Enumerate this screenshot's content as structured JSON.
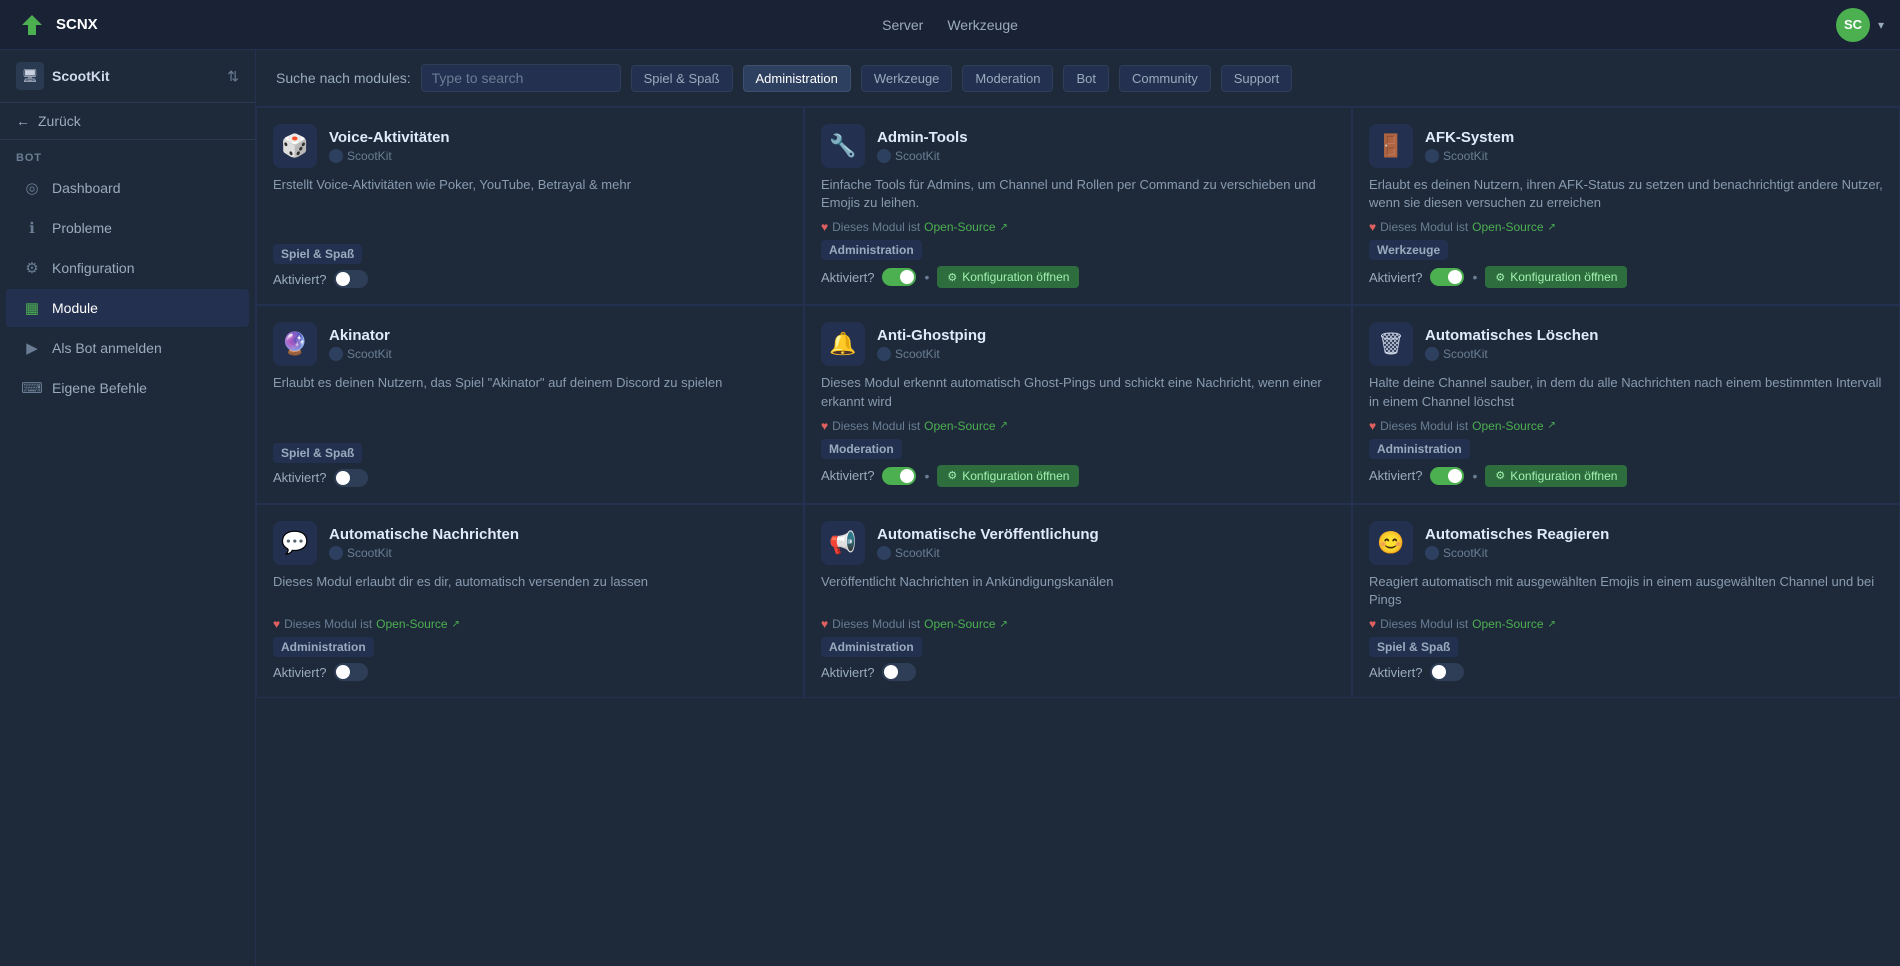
{
  "topnav": {
    "logo_text": "SCNX",
    "links": [
      "Server",
      "Werkzeuge"
    ],
    "avatar_initials": "SC"
  },
  "sidebar": {
    "server_name": "ScootKit",
    "back_label": "Zurück",
    "section_label": "BOT",
    "items": [
      {
        "id": "dashboard",
        "label": "Dashboard",
        "icon": "◎"
      },
      {
        "id": "problems",
        "label": "Probleme",
        "icon": "ℹ"
      },
      {
        "id": "config",
        "label": "Konfiguration",
        "icon": "⚙"
      },
      {
        "id": "modules",
        "label": "Module",
        "icon": "▦",
        "active": true
      },
      {
        "id": "bot-login",
        "label": "Als Bot anmelden",
        "icon": "▶"
      },
      {
        "id": "custom-commands",
        "label": "Eigene Befehle",
        "icon": "⌨"
      }
    ]
  },
  "filter_bar": {
    "label": "Suche nach modules:",
    "placeholder": "Type to search",
    "filters": [
      {
        "id": "spiel",
        "label": "Spiel & Spaß"
      },
      {
        "id": "administration",
        "label": "Administration",
        "active": true
      },
      {
        "id": "werkzeuge",
        "label": "Werkzeuge"
      },
      {
        "id": "moderation",
        "label": "Moderation"
      },
      {
        "id": "bot",
        "label": "Bot"
      },
      {
        "id": "community",
        "label": "Community"
      },
      {
        "id": "support",
        "label": "Support"
      }
    ]
  },
  "modules": [
    {
      "id": "voice-aktivitaeten",
      "icon": "🎲",
      "title": "Voice-Aktivitäten",
      "author": "ScootKit",
      "description": "Erstellt Voice-Aktivitäten wie Poker, YouTube, Betrayal & mehr",
      "opensource": false,
      "category": "Spiel & Spaß",
      "activated": false,
      "config_btn": false
    },
    {
      "id": "admin-tools",
      "icon": "🔧",
      "title": "Admin-Tools",
      "author": "ScootKit",
      "description": "Einfache Tools für Admins, um Channel und Rollen per Command zu verschieben und Emojis zu leihen.",
      "opensource": true,
      "opensource_label": "Dieses Modul ist",
      "opensource_link": "Open-Source",
      "category": "Administration",
      "activated": true,
      "config_btn": true,
      "config_label": "Konfiguration öffnen"
    },
    {
      "id": "afk-system",
      "icon": "🚪",
      "title": "AFK-System",
      "author": "ScootKit",
      "description": "Erlaubt es deinen Nutzern, ihren AFK-Status zu setzen und benachrichtigt andere Nutzer, wenn sie diesen versuchen zu erreichen",
      "opensource": true,
      "opensource_label": "Dieses Modul ist",
      "opensource_link": "Open-Source",
      "category": "Werkzeuge",
      "activated": true,
      "config_btn": true,
      "config_label": "Konfiguration öffnen"
    },
    {
      "id": "akinator",
      "icon": "🔮",
      "title": "Akinator",
      "author": "ScootKit",
      "description": "Erlaubt es deinen Nutzern, das Spiel \"Akinator\" auf deinem Discord zu spielen",
      "opensource": false,
      "category": "Spiel & Spaß",
      "activated": false,
      "config_btn": false
    },
    {
      "id": "anti-ghostping",
      "icon": "🔔",
      "title": "Anti-Ghostping",
      "author": "ScootKit",
      "description": "Dieses Modul erkennt automatisch Ghost-Pings und schickt eine Nachricht, wenn einer erkannt wird",
      "opensource": true,
      "opensource_label": "Dieses Modul ist",
      "opensource_link": "Open-Source",
      "category": "Moderation",
      "activated": true,
      "config_btn": true,
      "config_label": "Konfiguration öffnen"
    },
    {
      "id": "automatisches-loeschen",
      "icon": "🗑",
      "title": "Automatisches Löschen",
      "author": "ScootKit",
      "description": "Halte deine Channel sauber, in dem du alle Nachrichten nach einem bestimmten Intervall in einem Channel löschst",
      "opensource": true,
      "opensource_label": "Dieses Modul ist",
      "opensource_link": "Open-Source",
      "category": "Administration",
      "activated": true,
      "config_btn": true,
      "config_label": "Konfiguration öffnen"
    },
    {
      "id": "automatische-nachrichten",
      "icon": "💬",
      "title": "Automatische Nachrichten",
      "author": "ScootKit",
      "description": "Dieses Modul erlaubt dir es dir, automatisch versenden zu lassen",
      "opensource": true,
      "opensource_label": "Dieses Modul ist",
      "opensource_link": "Open-Source",
      "category": "Administration",
      "activated": false,
      "config_btn": false
    },
    {
      "id": "automatische-veroeffentlichung",
      "icon": "📢",
      "title": "Automatische Veröffentlichung",
      "author": "ScootKit",
      "description": "Veröffentlicht Nachrichten in Ankündigungskanälen",
      "opensource": true,
      "opensource_label": "Dieses Modul ist",
      "opensource_link": "Open-Source",
      "category": "Administration",
      "activated": false,
      "config_btn": false
    },
    {
      "id": "automatisches-reagieren",
      "icon": "😊",
      "title": "Automatisches Reagieren",
      "author": "ScootKit",
      "description": "Reagiert automatisch mit ausgewählten Emojis in einem ausgewählten Channel und bei Pings",
      "opensource": true,
      "opensource_label": "Dieses Modul ist",
      "opensource_link": "Open-Source",
      "category": "Spiel & Spaß",
      "activated": false,
      "config_btn": false
    }
  ],
  "labels": {
    "activate_label": "Aktiviert?",
    "config_label": "Konfiguration öffnen"
  }
}
